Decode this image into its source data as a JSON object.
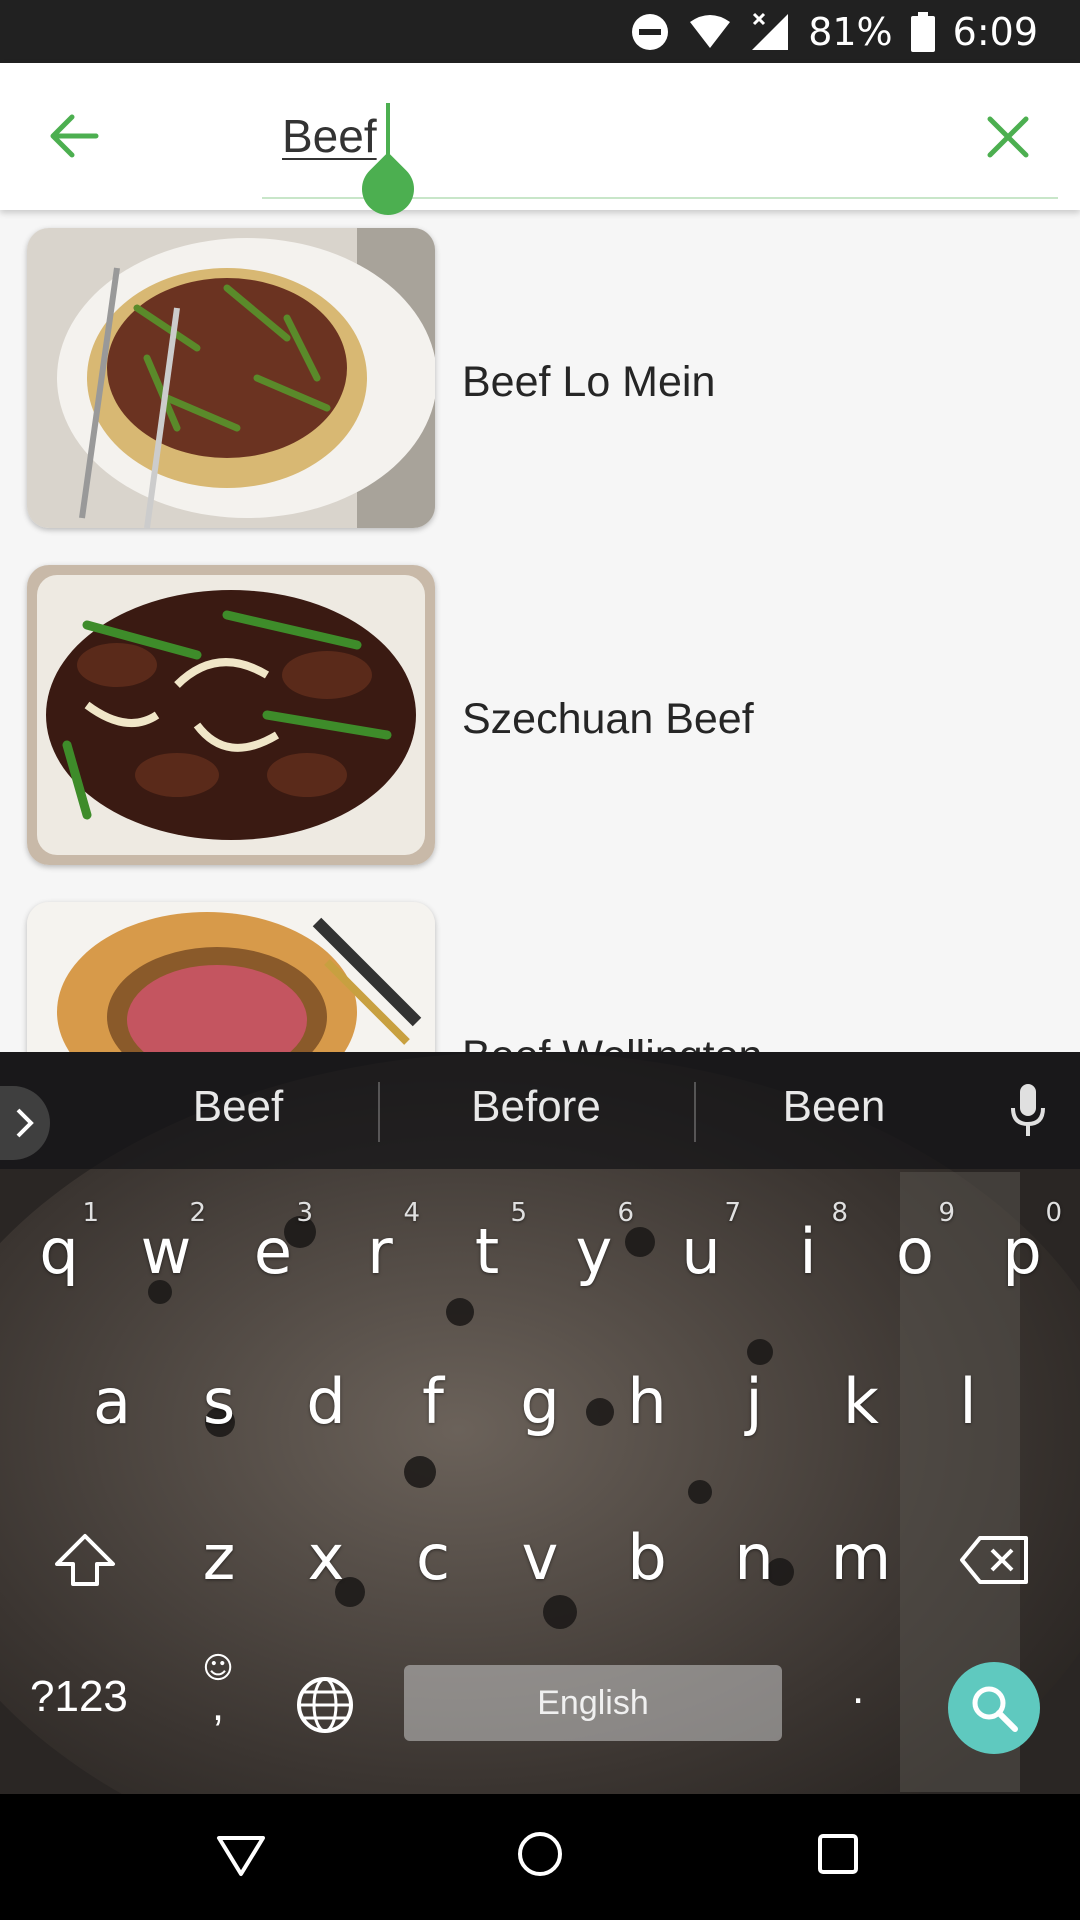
{
  "status_bar": {
    "battery_percent": "81%",
    "time": "6:09",
    "icons": [
      "do-not-disturb-icon",
      "wifi-icon",
      "signal-icon",
      "battery-icon"
    ]
  },
  "search": {
    "query": "Beef",
    "accent_color": "#4caf50"
  },
  "results": [
    {
      "title": "Beef Lo Mein",
      "image": "beef-lo-mein-photo"
    },
    {
      "title": "Szechuan Beef",
      "image": "szechuan-beef-photo"
    },
    {
      "title": "Beef Wellington",
      "image": "beef-wellington-photo"
    }
  ],
  "keyboard": {
    "suggestions": [
      "Beef",
      "Before",
      "Been"
    ],
    "row1": [
      {
        "key": "q",
        "hint": "1"
      },
      {
        "key": "w",
        "hint": "2"
      },
      {
        "key": "e",
        "hint": "3"
      },
      {
        "key": "r",
        "hint": "4"
      },
      {
        "key": "t",
        "hint": "5"
      },
      {
        "key": "y",
        "hint": "6"
      },
      {
        "key": "u",
        "hint": "7"
      },
      {
        "key": "i",
        "hint": "8"
      },
      {
        "key": "o",
        "hint": "9"
      },
      {
        "key": "p",
        "hint": "0"
      }
    ],
    "row2": [
      "a",
      "s",
      "d",
      "f",
      "g",
      "h",
      "j",
      "k",
      "l"
    ],
    "row3": [
      "z",
      "x",
      "c",
      "v",
      "b",
      "n",
      "m"
    ],
    "symbols_label": "?123",
    "emoji_label": "☺",
    "comma_label": ",",
    "space_label": "English",
    "period_label": ".",
    "search_key_color": "#5fc9bf"
  },
  "nav_bar": {
    "buttons": [
      "back-icon",
      "home-icon",
      "recents-icon"
    ]
  }
}
